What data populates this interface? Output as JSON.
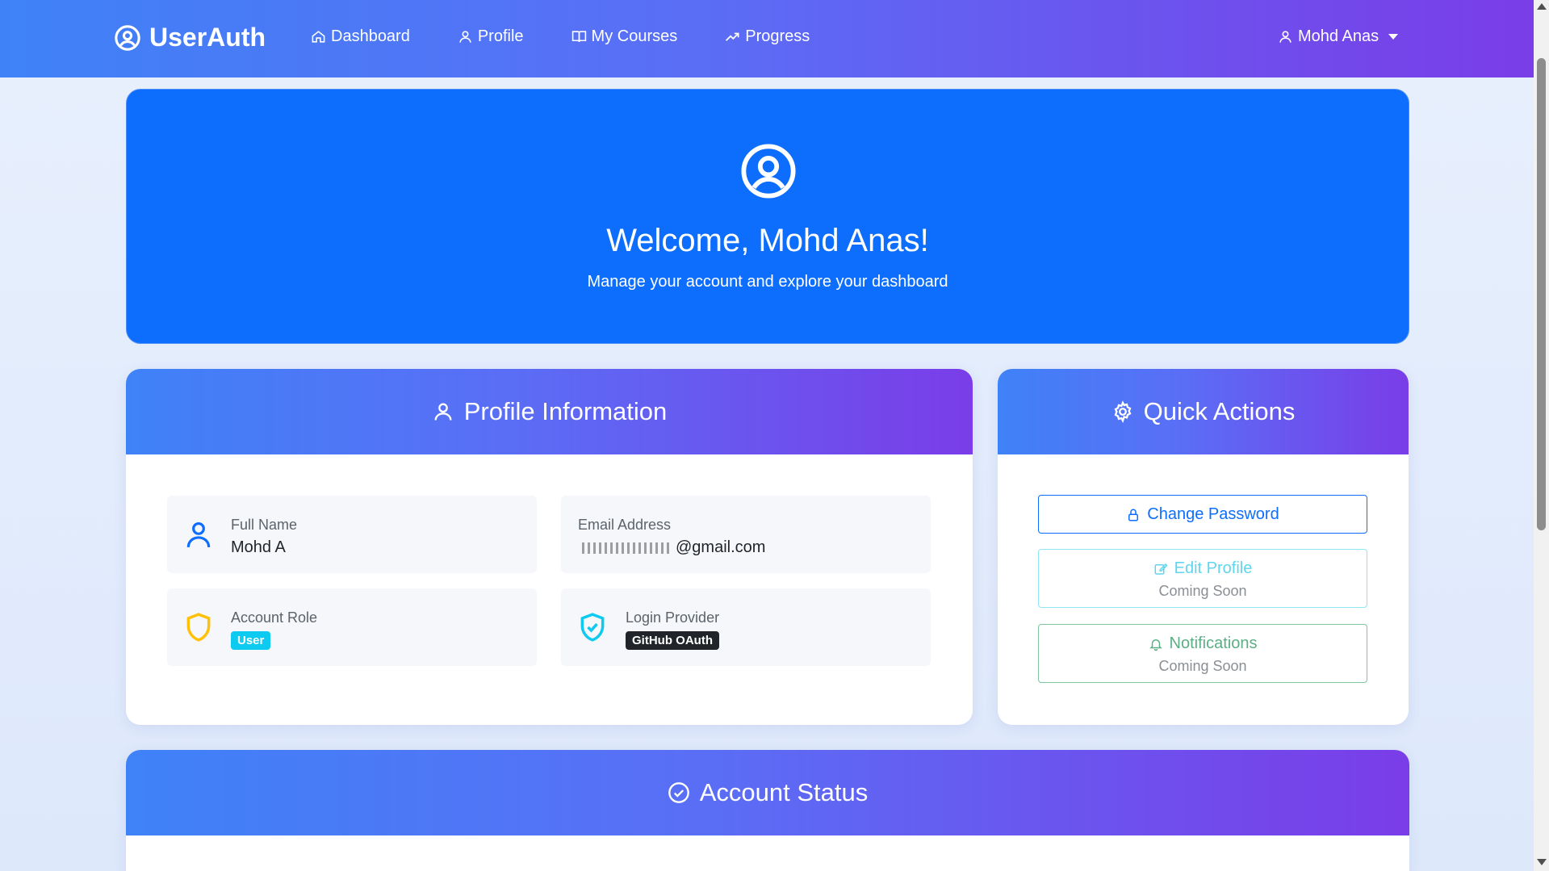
{
  "navbar": {
    "brand": "UserAuth",
    "links": [
      {
        "label": "Dashboard",
        "icon": "home-icon"
      },
      {
        "label": "Profile",
        "icon": "person-icon"
      },
      {
        "label": "My Courses",
        "icon": "book-icon"
      },
      {
        "label": "Progress",
        "icon": "trending-up-icon"
      }
    ],
    "user_name": "Mohd Anas"
  },
  "hero": {
    "title": "Welcome, Mohd Anas!",
    "subtitle": "Manage your account and explore your dashboard"
  },
  "profile": {
    "header": "Profile Information",
    "full_name_label": "Full Name",
    "full_name_value": "Mohd A",
    "email_label": "Email Address",
    "email_value": "@gmail.com",
    "role_label": "Account Role",
    "role_value": "User",
    "provider_label": "Login Provider",
    "provider_value": "GitHub OAuth"
  },
  "actions": {
    "header": "Quick Actions",
    "change_password": "Change Password",
    "edit_profile": "Edit Profile",
    "edit_profile_sub": "Coming Soon",
    "notifications": "Notifications",
    "notifications_sub": "Coming Soon"
  },
  "status": {
    "header": "Account Status"
  },
  "colors": {
    "primary": "#0d6efd",
    "info": "#0dcaf0",
    "success": "#198754",
    "warning": "#ffc107",
    "dark": "#212529"
  }
}
